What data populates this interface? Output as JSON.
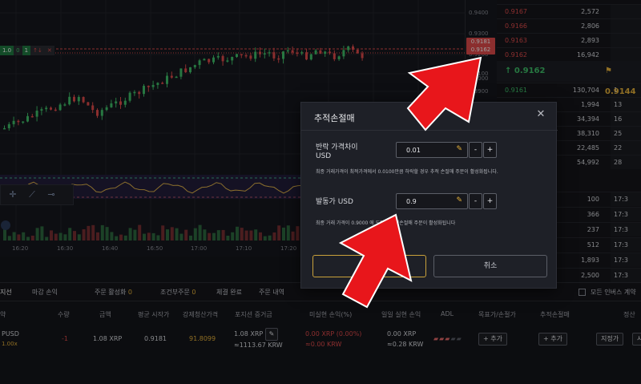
{
  "chart": {
    "price_labels": [
      "0.9400",
      "0.9300",
      "0.9200",
      "0.9181",
      "0.9162",
      "0.9100",
      "0.9000",
      "0.8900"
    ],
    "time_labels": [
      "16:20",
      "16:30",
      "16:40",
      "16:50",
      "17:00",
      "17:10",
      "17:20"
    ],
    "order_tag": {
      "count": "1.0",
      "value": "0",
      "qty": "1",
      "arrows": "↑↓"
    },
    "tools": [
      "crosshair-tool",
      "trendline-tool",
      "horizontal-line-tool"
    ]
  },
  "order_book": {
    "asks": [
      {
        "price": "0.9167",
        "qty": "2,572"
      },
      {
        "price": "0.9166",
        "qty": "2,806"
      },
      {
        "price": "0.9163",
        "qty": "2,893"
      },
      {
        "price": "0.9162",
        "qty": "16,942"
      }
    ],
    "mid": {
      "last": "↑ 0.9162",
      "mark": "⚑ 0.9144"
    },
    "bids": [
      {
        "price": "0.9161",
        "qty": "130,704",
        "side": "1"
      },
      {
        "price": "",
        "qty": "1,994",
        "side": "13"
      },
      {
        "price": "",
        "qty": "34,394",
        "side": "16"
      },
      {
        "price": "",
        "qty": "38,310",
        "side": "25"
      },
      {
        "price": "",
        "qty": "22,485",
        "side": "22"
      },
      {
        "price": "",
        "qty": "54,992",
        "side": "28"
      }
    ],
    "trades": [
      {
        "qty": "100",
        "time": "17:3"
      },
      {
        "qty": "366",
        "time": "17:3"
      },
      {
        "qty": "237",
        "time": "17:3"
      },
      {
        "qty": "512",
        "time": "17:3"
      },
      {
        "qty": "1,893",
        "time": "17:3"
      },
      {
        "qty": "2,500",
        "time": "17:3"
      }
    ]
  },
  "tabs": {
    "position": "지선",
    "settle": "마감 손익",
    "active_orders": "주문 활성화",
    "active_orders_count": "0",
    "conditional": "조건부주문",
    "conditional_count": "0",
    "filled": "체결 완료",
    "history": "주문 내역",
    "all_inverse": "모든 인버스 계약"
  },
  "table": {
    "headers": [
      "약",
      "수량",
      "금액",
      "평균 시작가",
      "강제청산가격",
      "포지션 증거금",
      "미실현 손익(%)",
      "일일 실현 손익",
      "ADL",
      "목표가/손절가",
      "추적손절매",
      "정산"
    ],
    "row": {
      "symbol": "PUSD",
      "leverage": "1.00x",
      "qty": "-1",
      "amount": "1.08 XRP",
      "avg_entry": "0.9181",
      "liq_price": "91.8099",
      "margin": "1.08 XRP",
      "margin_krw": "≈1113.67 KRW",
      "unrealized": "0.00 XRP (0.00%)",
      "unrealized_krw": "≈0.00 KRW",
      "daily_realized": "0.00 XRP",
      "daily_realized_krw": "≈0.28 KRW",
      "tp_sl_button": "+ 추가",
      "trailing_button": "+ 추가",
      "limit_button": "지정가",
      "market_button": "시"
    }
  },
  "modal": {
    "title": "추적손절매",
    "retrace_label": "반락 가격차이",
    "retrace_unit": "USD",
    "retrace_value": "0.01",
    "retrace_hint": "최종 거래가격이 최적가격에서 0.0100만큼 하락할 경우 추적 손절매 주문이 활성화됩니다.",
    "trigger_label": "발동가 USD",
    "trigger_value": "0.9",
    "trigger_hint": "최종 거래 가격이 0.9000 에 도달시 추적손절매 주문이 활성화됩니다",
    "ok_button": "확인",
    "cancel_button": "취소"
  },
  "colors": {
    "up": "#3fc06a",
    "down": "#e14b4b",
    "accent": "#e8b33a",
    "annotation_arrow": "#e8161b"
  }
}
